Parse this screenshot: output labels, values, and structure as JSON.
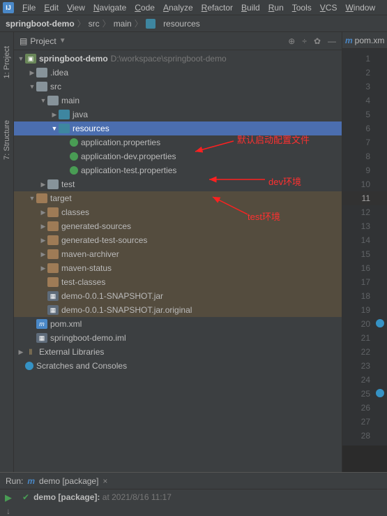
{
  "menu": [
    "File",
    "Edit",
    "View",
    "Navigate",
    "Code",
    "Analyze",
    "Refactor",
    "Build",
    "Run",
    "Tools",
    "VCS",
    "Window"
  ],
  "breadcrumb": {
    "project": "springboot-demo",
    "parts": [
      "src",
      "main",
      "resources"
    ]
  },
  "panel": {
    "title": "Project",
    "sidebar": {
      "project": "1: Project",
      "structure": "7: Structure"
    }
  },
  "tree": {
    "root": {
      "name": "springboot-demo",
      "path": "D:\\workspace\\springboot-demo"
    },
    "idea": ".idea",
    "src": "src",
    "main": "main",
    "java": "java",
    "resources": "resources",
    "app_prop": "application.properties",
    "app_dev": "application-dev.properties",
    "app_test": "application-test.properties",
    "test": "test",
    "target": "target",
    "classes": "classes",
    "gen_src": "generated-sources",
    "gen_test": "generated-test-sources",
    "mvn_arch": "maven-archiver",
    "mvn_stat": "maven-status",
    "test_cls": "test-classes",
    "jar": "demo-0.0.1-SNAPSHOT.jar",
    "jar_orig": "demo-0.0.1-SNAPSHOT.jar.original",
    "pom": "pom.xml",
    "iml": "springboot-demo.iml",
    "ext_lib": "External Libraries",
    "scratch": "Scratches and Consoles"
  },
  "editor": {
    "tab": "pom.xml",
    "lines": 28,
    "current": 11,
    "marks": [
      20,
      25
    ]
  },
  "annotations": {
    "default": "默认启动配置文件",
    "dev": "dev环境",
    "test": "test环境"
  },
  "run": {
    "label": "Run:",
    "config": "demo [package]",
    "task": "demo [package]:",
    "time": "at 2021/8/16 11:17"
  }
}
